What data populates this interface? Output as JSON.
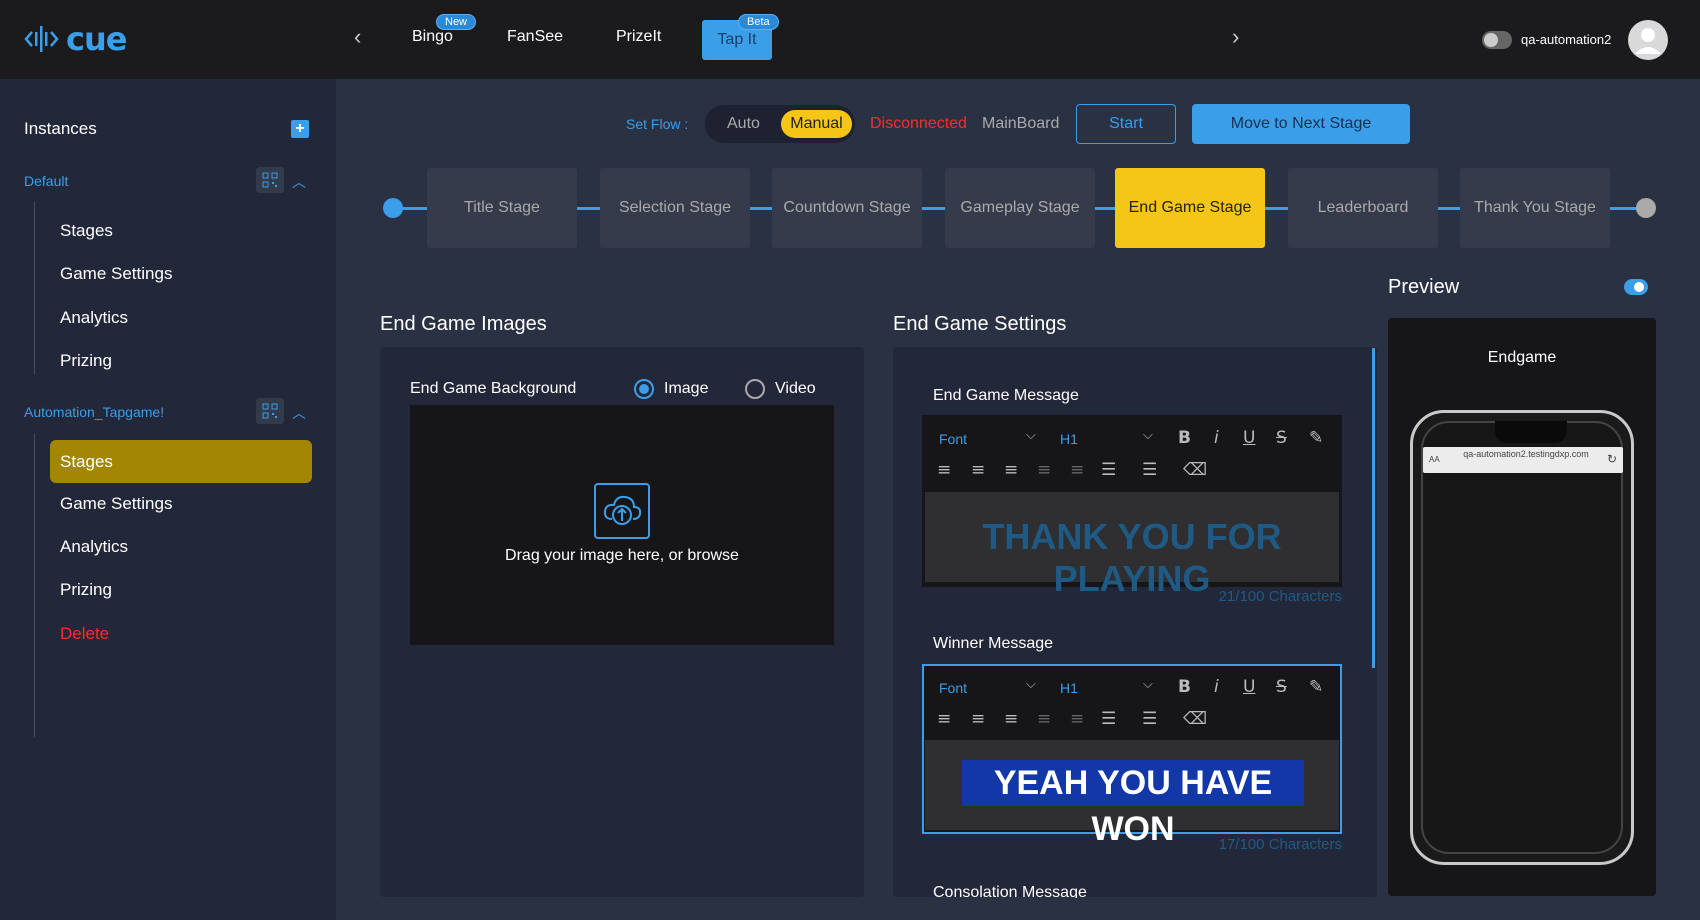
{
  "app": {
    "logo_text": "cue",
    "brand_color": "#3a9ee8",
    "accent_color": "#f5c518"
  },
  "nav": {
    "tabs": [
      {
        "label": "Bingo",
        "badge": "New"
      },
      {
        "label": "FanSee"
      },
      {
        "label": "PrizeIt"
      },
      {
        "label": "Tap It",
        "badge": "Beta",
        "active": true
      }
    ],
    "prev_icon": "chevron-left-icon",
    "next_icon": "chevron-right-icon"
  },
  "user": {
    "name": "qa-automation2"
  },
  "sidebar": {
    "title": "Instances",
    "groups": [
      {
        "name": "Default",
        "items": [
          "Stages",
          "Game Settings",
          "Analytics",
          "Prizing"
        ]
      },
      {
        "name": "Automation_Tapgame!",
        "items": [
          "Stages",
          "Game Settings",
          "Analytics",
          "Prizing",
          "Delete"
        ],
        "active_item": "Stages"
      }
    ]
  },
  "flow": {
    "label": "Set Flow :",
    "auto": "Auto",
    "manual": "Manual",
    "status_disconnected": "Disconnected",
    "status_board": "MainBoard",
    "start": "Start",
    "next": "Move to Next Stage"
  },
  "stages": [
    "Title Stage",
    "Selection Stage",
    "Countdown Stage",
    "Gameplay Stage",
    "End Game Stage",
    "Leaderboard",
    "Thank You Stage"
  ],
  "active_stage": "End Game Stage",
  "images": {
    "title": "End Game Images",
    "background_label": "End Game Background",
    "opt_image": "Image",
    "opt_video": "Video",
    "drop_text": "Drag your image here, or browse"
  },
  "settings": {
    "title": "End Game Settings",
    "toolbar": {
      "font": "Font",
      "heading": "H1"
    },
    "end_message": {
      "label": "End Game Message",
      "text": "THANK YOU FOR PLAYING",
      "count": "21/100 Characters"
    },
    "winner_message": {
      "label": "Winner Message",
      "text": "YEAH YOU HAVE WON",
      "count": "17/100 Characters"
    },
    "consolation_label": "Consolation Message"
  },
  "preview": {
    "title": "Preview",
    "screen_name": "Endgame",
    "url": "qa-automation2.testingdxp.com",
    "aa": "AA"
  }
}
